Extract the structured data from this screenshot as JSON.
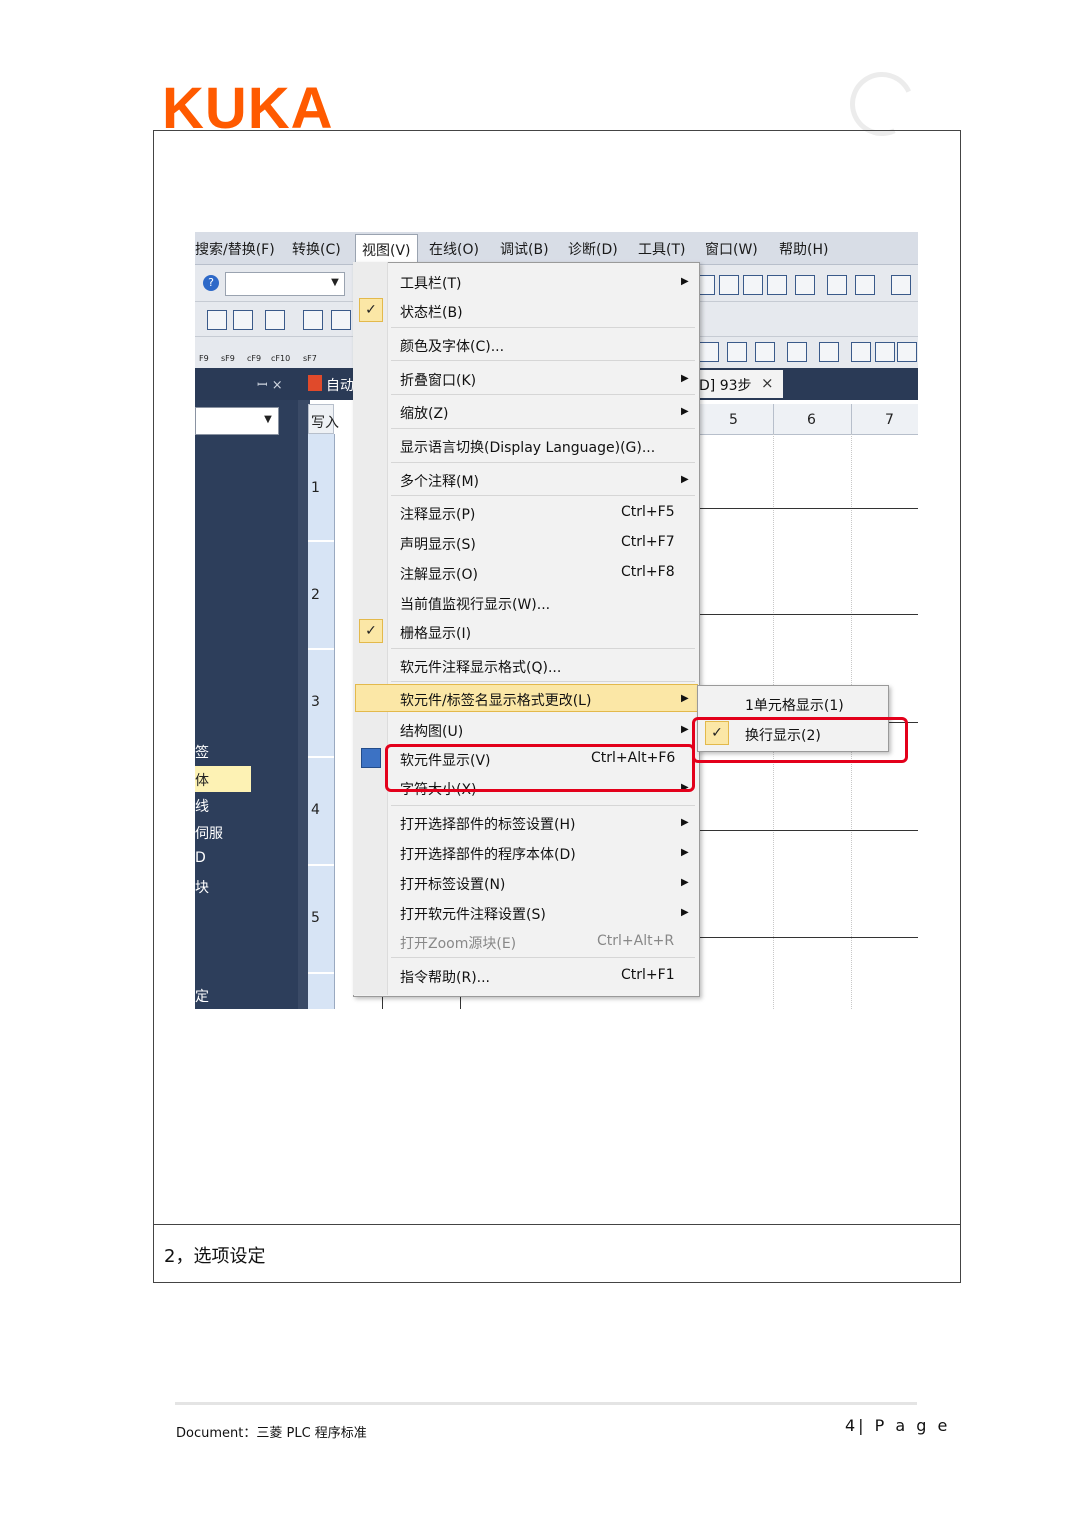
{
  "header": {
    "logo": "KUKA"
  },
  "menubar": {
    "items": [
      "搜索/替换(F)",
      "转换(C)",
      "视图(V)",
      "在线(O)",
      "调试(B)",
      "诊断(D)",
      "工具(T)",
      "窗口(W)",
      "帮助(H)"
    ]
  },
  "toolbar": {
    "fkeys": [
      "F9",
      "sF9",
      "cF9",
      "cF10",
      "sF7"
    ]
  },
  "nav": {
    "pin_close": "ꟷ ×",
    "items": [
      "签",
      "体",
      "线",
      "伺服",
      "D",
      "块",
      "定"
    ]
  },
  "editor": {
    "tab_left": "自动",
    "tab_right": "D] 93步",
    "tab_close": "×",
    "mode": "写入",
    "rows": [
      "1",
      "2",
      "3",
      "4",
      "5"
    ],
    "columns": [
      "5",
      "6",
      "7"
    ]
  },
  "view_menu": {
    "items": [
      {
        "label": "工具栏(T)",
        "submenu": true
      },
      {
        "label": "状态栏(B)",
        "checked": true
      },
      {
        "label": "颜色及字体(C)..."
      },
      {
        "label": "折叠窗口(K)",
        "submenu": true
      },
      {
        "label": "缩放(Z)",
        "submenu": true
      },
      {
        "label": "显示语言切换(Display Language)(G)..."
      },
      {
        "label": "多个注释(M)",
        "submenu": true
      },
      {
        "label": "注释显示(P)",
        "shortcut": "Ctrl+F5"
      },
      {
        "label": "声明显示(S)",
        "shortcut": "Ctrl+F7"
      },
      {
        "label": "注解显示(O)",
        "shortcut": "Ctrl+F8"
      },
      {
        "label": "当前值监视行显示(W)..."
      },
      {
        "label": "栅格显示(I)",
        "checked": true
      },
      {
        "label": "软元件注释显示格式(Q)..."
      },
      {
        "label": "软元件/标签名显示格式更改(L)",
        "submenu": true,
        "highlighted": true
      },
      {
        "label": "结构图(U)",
        "submenu": true
      },
      {
        "label": "软元件显示(V)",
        "shortcut": "Ctrl+Alt+F6"
      },
      {
        "label": "字符大小(X)",
        "submenu": true
      },
      {
        "label": "打开选择部件的标签设置(H)",
        "submenu": true
      },
      {
        "label": "打开选择部件的程序本体(D)",
        "submenu": true
      },
      {
        "label": "打开标签设置(N)",
        "submenu": true
      },
      {
        "label": "打开软元件注释设置(S)",
        "submenu": true
      },
      {
        "label": "打开Zoom源块(E)",
        "shortcut": "Ctrl+Alt+R",
        "disabled": true
      },
      {
        "label": "指令帮助(R)...",
        "shortcut": "Ctrl+F1"
      }
    ]
  },
  "submenu": {
    "items": [
      {
        "label": "1单元格显示(1)"
      },
      {
        "label": "换行显示(2)",
        "checked": true
      }
    ]
  },
  "caption": "2，选项设定",
  "footer": {
    "document": "Document：三菱 PLC 程序标准",
    "page": "4| P a g e"
  },
  "colors": {
    "brand": "#ff5a00",
    "highlight_box": "#e3001b",
    "nav_bg": "#2d3e5b"
  }
}
